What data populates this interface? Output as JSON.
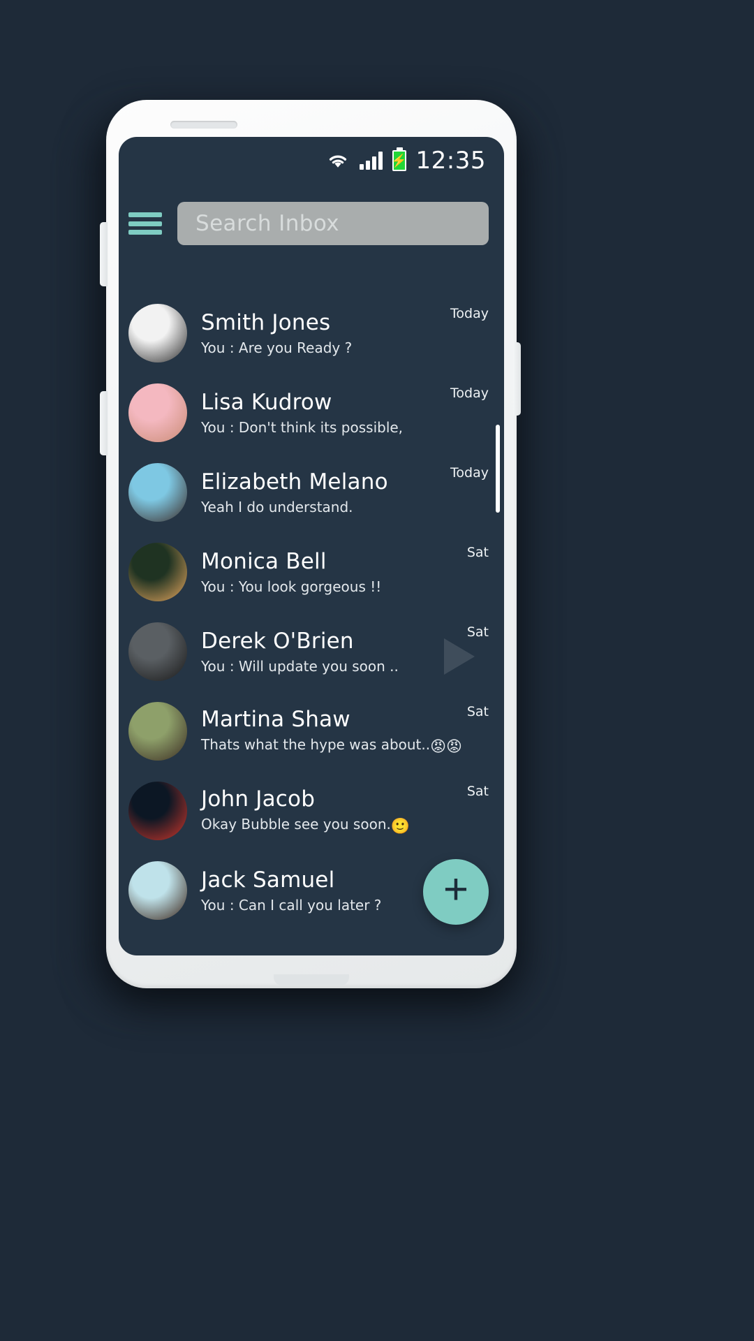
{
  "device": {
    "frame_color": "#f2f4f5",
    "screen_bg": "#253545"
  },
  "status_bar": {
    "wifi_icon": "wifi-icon",
    "signal_icon": "signal-bars-icon",
    "battery_icon": "battery-charging-icon",
    "battery_color": "#22d637",
    "time": "12:35"
  },
  "top_bar": {
    "menu_icon": "hamburger-menu-icon",
    "menu_color": "#7fccc2",
    "search": {
      "placeholder": "Search Inbox",
      "value": "",
      "field_color": "#a9adad"
    }
  },
  "chats": [
    {
      "name": "Smith Jones",
      "preview": "You : Are you Ready ?",
      "time": "Today",
      "avatar_desc": "bw-portrait-curly-hair-man",
      "avatar_colors": [
        "#f2f2f2",
        "#2b2b2b"
      ]
    },
    {
      "name": "Lisa Kudrow",
      "preview": "You :  Don't think its possible,",
      "time": "Today",
      "avatar_desc": "woman-pink-headphones",
      "avatar_colors": [
        "#f4b8c0",
        "#c98b74"
      ]
    },
    {
      "name": "Elizabeth Melano",
      "preview": "Yeah I do understand.",
      "time": "Today",
      "avatar_desc": "woman-blue-sky-white-top",
      "avatar_colors": [
        "#7ec8e3",
        "#3b2a25"
      ]
    },
    {
      "name": "Monica Bell",
      "preview": "You : You look gorgeous !!",
      "time": "Sat",
      "avatar_desc": "woman-golden-sunlight-forest",
      "avatar_colors": [
        "#1f3322",
        "#e8a85f"
      ]
    },
    {
      "name": "Derek O'Brien",
      "preview": "You :  Will update you soon ..",
      "time": "Sat",
      "avatar_desc": "young-man-black-shirt-grey-wall",
      "avatar_colors": [
        "#5a5f63",
        "#181818"
      ]
    },
    {
      "name": "Martina Shaw",
      "preview": "Thats what the hype was about..",
      "preview_emoji": "😡😡",
      "time": "Sat",
      "avatar_desc": "smiling-woman-outdoors-sunset",
      "avatar_colors": [
        "#8ea06a",
        "#3a2b22"
      ]
    },
    {
      "name": "John Jacob",
      "preview": "Okay Bubble see you soon.",
      "preview_emoji": "🙂",
      "time": "Sat",
      "avatar_desc": "man-red-neon-dark-portrait",
      "avatar_colors": [
        "#0c1724",
        "#d2372b"
      ]
    },
    {
      "name": "Jack Samuel",
      "preview": "You : Can I call you later ?",
      "time": "",
      "avatar_desc": "man-chain-necklace-blue-sky",
      "avatar_colors": [
        "#bfe2ea",
        "#3a2317"
      ]
    }
  ],
  "fab": {
    "label": "+",
    "color": "#7fccc2",
    "icon": "plus-icon"
  }
}
